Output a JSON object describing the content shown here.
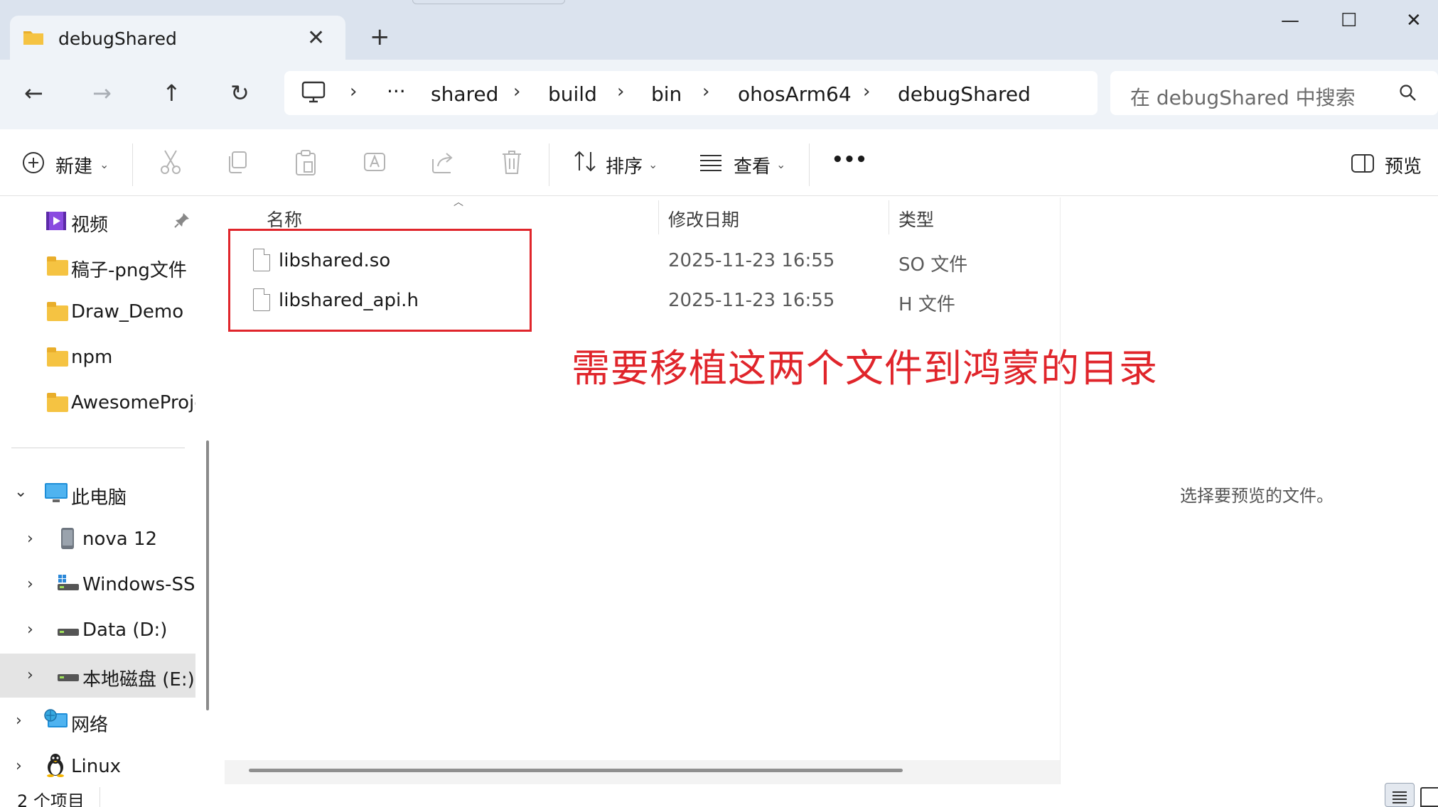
{
  "window": {
    "tab_title": "debugShared",
    "minimize": "—",
    "maximize": "☐",
    "close": "✕",
    "new_tab": "+"
  },
  "nav": {
    "back": "←",
    "forward": "→",
    "up": "↑",
    "refresh": "↻"
  },
  "breadcrumb": {
    "ellipsis": "···",
    "items": [
      "shared",
      "build",
      "bin",
      "ohosArm64",
      "debugShared"
    ],
    "separator": "›"
  },
  "search": {
    "placeholder": "在 debugShared 中搜索"
  },
  "commands": {
    "new": "新建",
    "sort": "排序",
    "view": "查看",
    "more": "•••",
    "preview": "预览"
  },
  "sidebar": {
    "quick_access": [
      {
        "label": "视频"
      },
      {
        "label": "稿子-png文件"
      },
      {
        "label": "Draw_Demo"
      },
      {
        "label": "npm"
      },
      {
        "label": "AwesomeProje"
      }
    ],
    "this_pc": {
      "label": "此电脑"
    },
    "drives": [
      {
        "label": "nova 12"
      },
      {
        "label": "Windows-SSD"
      },
      {
        "label": "Data (D:)"
      },
      {
        "label": "本地磁盘 (E:)"
      }
    ],
    "network": {
      "label": "网络"
    },
    "linux": {
      "label": "Linux"
    }
  },
  "columns": {
    "name": "名称",
    "modified": "修改日期",
    "type": "类型"
  },
  "files": [
    {
      "name": "libshared.so",
      "modified": "2025-11-23 16:55",
      "type": "SO 文件"
    },
    {
      "name": "libshared_api.h",
      "modified": "2025-11-23 16:55",
      "type": "H 文件"
    }
  ],
  "annotation": {
    "text": "需要移植这两个文件到鸿蒙的目录",
    "color": "#e0252b"
  },
  "preview_pane": {
    "message": "选择要预览的文件。"
  },
  "status": {
    "item_count": "2 个项目"
  },
  "colors": {
    "titlebar_bg": "#dbe3ee",
    "navbar_bg": "#eff3f8",
    "folder_yellow": "#f5c342"
  }
}
